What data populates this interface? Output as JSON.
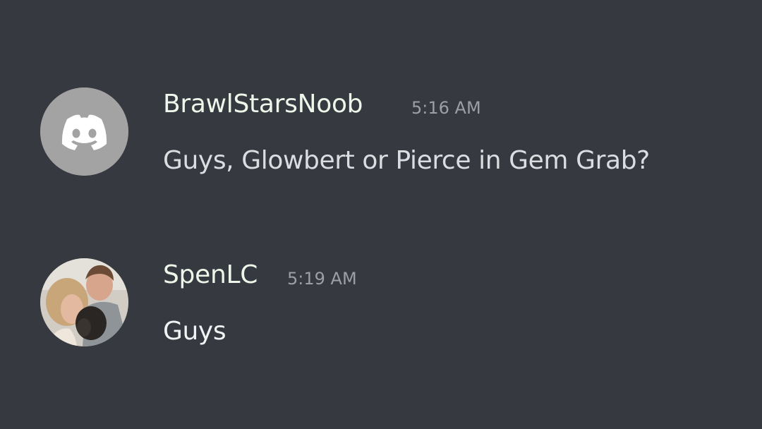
{
  "colors": {
    "background": "#363940",
    "username": "#eef6ea",
    "timestamp": "#9c9fa6",
    "message_text": "#dcdde0",
    "default_avatar_bg": "#a3a3a3"
  },
  "messages": [
    {
      "avatar": "discord-logo-icon",
      "username": "BrawlStarsNoob",
      "timestamp": "5:16 AM",
      "content": "Guys, Glowbert or Pierce in Gem Grab?"
    },
    {
      "avatar": "profile-photo",
      "username": "SpenLC",
      "timestamp": "5:19 AM",
      "content": "Guys"
    }
  ]
}
